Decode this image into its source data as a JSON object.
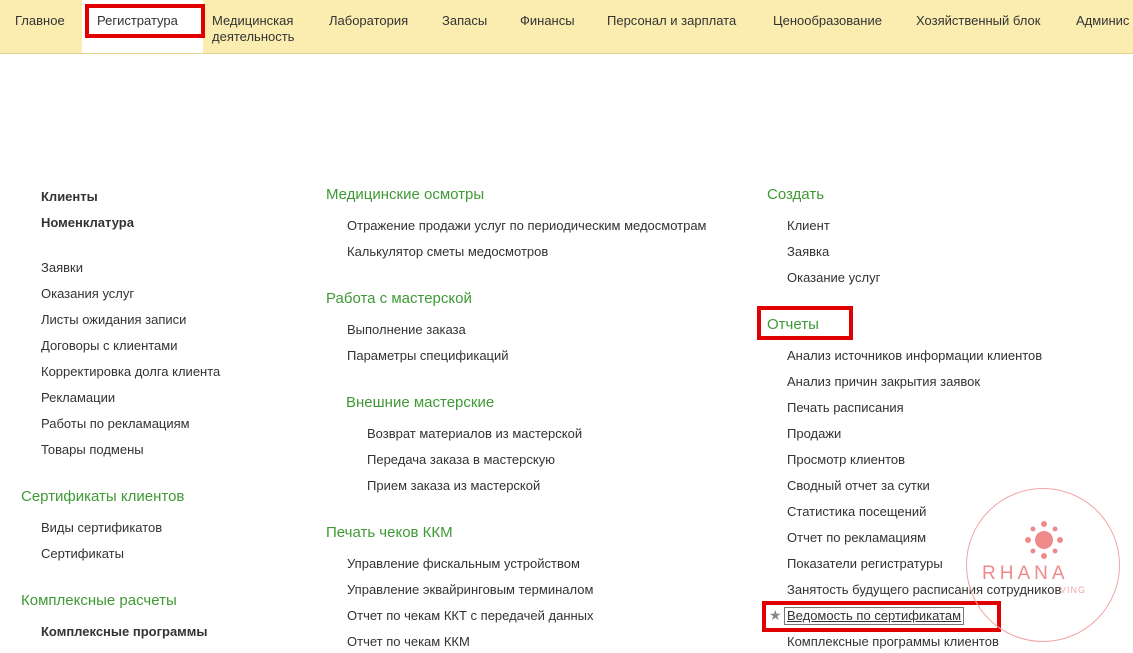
{
  "menu": {
    "tabs": [
      {
        "label": "Главное"
      },
      {
        "label": "Регистратура"
      },
      {
        "label": "Медицинская деятельность"
      },
      {
        "label": "Лаборатория"
      },
      {
        "label": "Запасы"
      },
      {
        "label": "Финансы"
      },
      {
        "label": "Персонал и зарплата"
      },
      {
        "label": "Ценообразование"
      },
      {
        "label": "Хозяйственный блок"
      },
      {
        "label": "Админис"
      }
    ]
  },
  "col1": {
    "top": [
      "Клиенты",
      "Номенклатура"
    ],
    "items": [
      "Заявки",
      "Оказания услуг",
      "Листы ожидания записи",
      "Договоры с клиентами",
      "Корректировка долга клиента",
      "Рекламации",
      "Работы по рекламациям",
      "Товары подмены"
    ],
    "cert_group": "Сертификаты клиентов",
    "cert_items": [
      "Виды сертификатов",
      "Сертификаты"
    ],
    "complex_group": "Комплексные расчеты",
    "complex_items": [
      "Комплексные программы"
    ]
  },
  "col2": {
    "med_group": "Медицинские осмотры",
    "med_items": [
      "Отражение продажи услуг по периодическим медосмотрам",
      "Калькулятор сметы медосмотров"
    ],
    "workshop_group": "Работа с мастерской",
    "workshop_items": [
      "Выполнение заказа",
      "Параметры спецификаций"
    ],
    "ext_group": "Внешние мастерские",
    "ext_items": [
      "Возврат материалов из мастерской",
      "Передача заказа в мастерскую",
      "Прием заказа из мастерской"
    ],
    "kkm_group": "Печать чеков ККМ",
    "kkm_items": [
      "Управление фискальным устройством",
      "Управление эквайринговым терминалом",
      "Отчет по чекам ККТ с передачей данных",
      "Отчет по чекам ККМ"
    ]
  },
  "col3": {
    "create_group": "Создать",
    "create_items": [
      "Клиент",
      "Заявка",
      "Оказание услуг"
    ],
    "reports_group": "Отчеты",
    "reports_items": [
      "Анализ источников информации клиентов",
      "Анализ причин закрытия заявок",
      "Печать расписания",
      "Продажи",
      "Просмотр клиентов",
      "Сводный отчет за сутки",
      "Статистика посещений",
      "Отчет по рекламациям",
      "Показатели регистратуры",
      "Занятость будущего расписания сотрудников",
      "Ведомость по сертификатам",
      "Комплексные программы клиентов"
    ]
  },
  "watermark": {
    "text": "RHANA",
    "sub": "VING"
  },
  "colors": {
    "menu_bg": "#fbedb0",
    "group_green": "#3f9a35",
    "highlight_red": "#e00000"
  },
  "icons": [
    "star-icon",
    "rhana-logo-icon"
  ]
}
